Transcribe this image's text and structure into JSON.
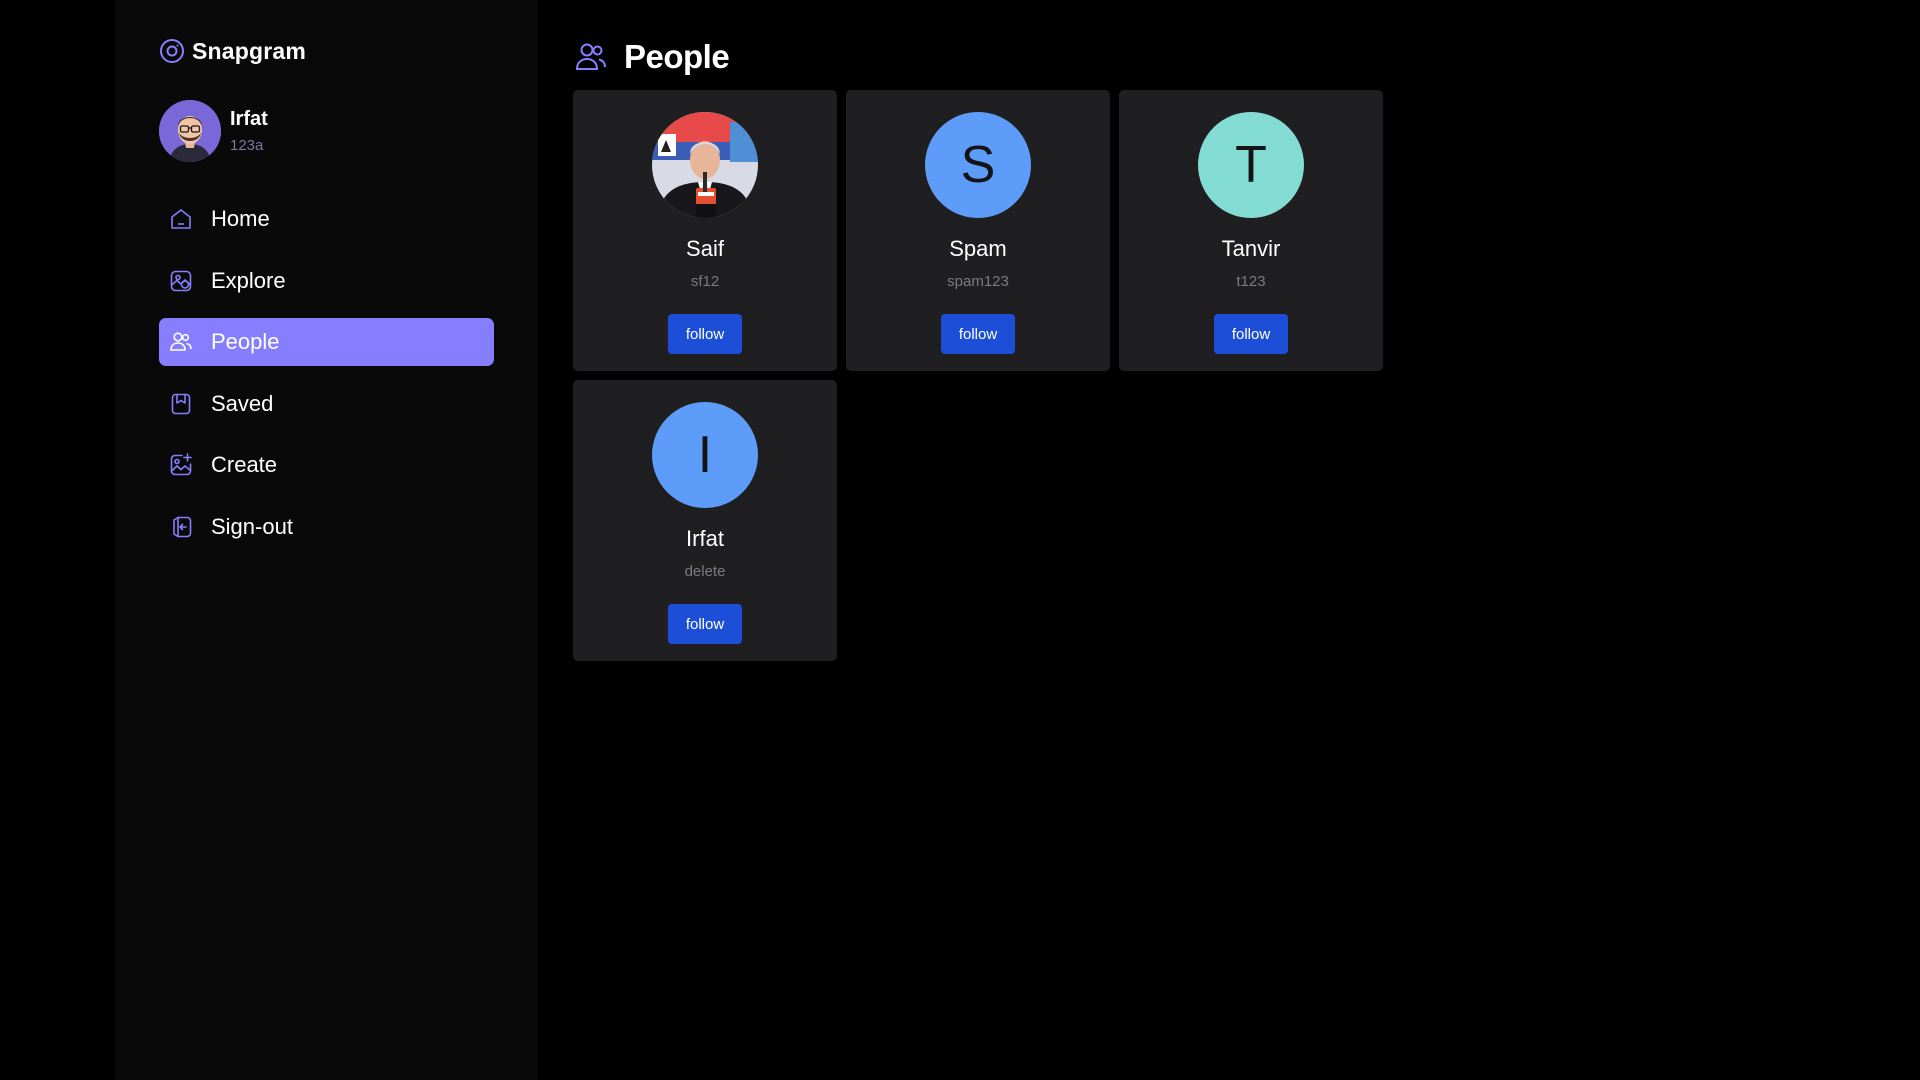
{
  "app": {
    "name": "Snapgram"
  },
  "user": {
    "name": "Irfat",
    "handle": "123a"
  },
  "nav": {
    "items": [
      {
        "label": "Home",
        "icon": "home-icon"
      },
      {
        "label": "Explore",
        "icon": "explore-icon"
      },
      {
        "label": "People",
        "icon": "people-icon",
        "active": true
      },
      {
        "label": "Saved",
        "icon": "bookmark-icon"
      },
      {
        "label": "Create",
        "icon": "create-image-icon"
      },
      {
        "label": "Sign-out",
        "icon": "sign-out-icon"
      }
    ]
  },
  "page": {
    "title": "People",
    "icon": "people-icon"
  },
  "people": [
    {
      "name": "Saif",
      "handle": "sf12",
      "initial": "",
      "avatar_type": "photo",
      "avatar_color": "",
      "button": "follow"
    },
    {
      "name": "Spam",
      "handle": "spam123",
      "initial": "S",
      "avatar_type": "initial",
      "avatar_color": "#5d9cf8",
      "button": "follow"
    },
    {
      "name": "Tanvir",
      "handle": "t123",
      "initial": "T",
      "avatar_type": "initial",
      "avatar_color": "#83dcd4",
      "button": "follow"
    },
    {
      "name": "Irfat",
      "handle": "delete",
      "initial": "I",
      "avatar_type": "initial",
      "avatar_color": "#5d9cf8",
      "button": "follow"
    }
  ],
  "colors": {
    "accent": "#877eff",
    "follow_button": "#1d4ed8",
    "card_background": "#1f1f22",
    "sidebar_background": "#09090a"
  }
}
